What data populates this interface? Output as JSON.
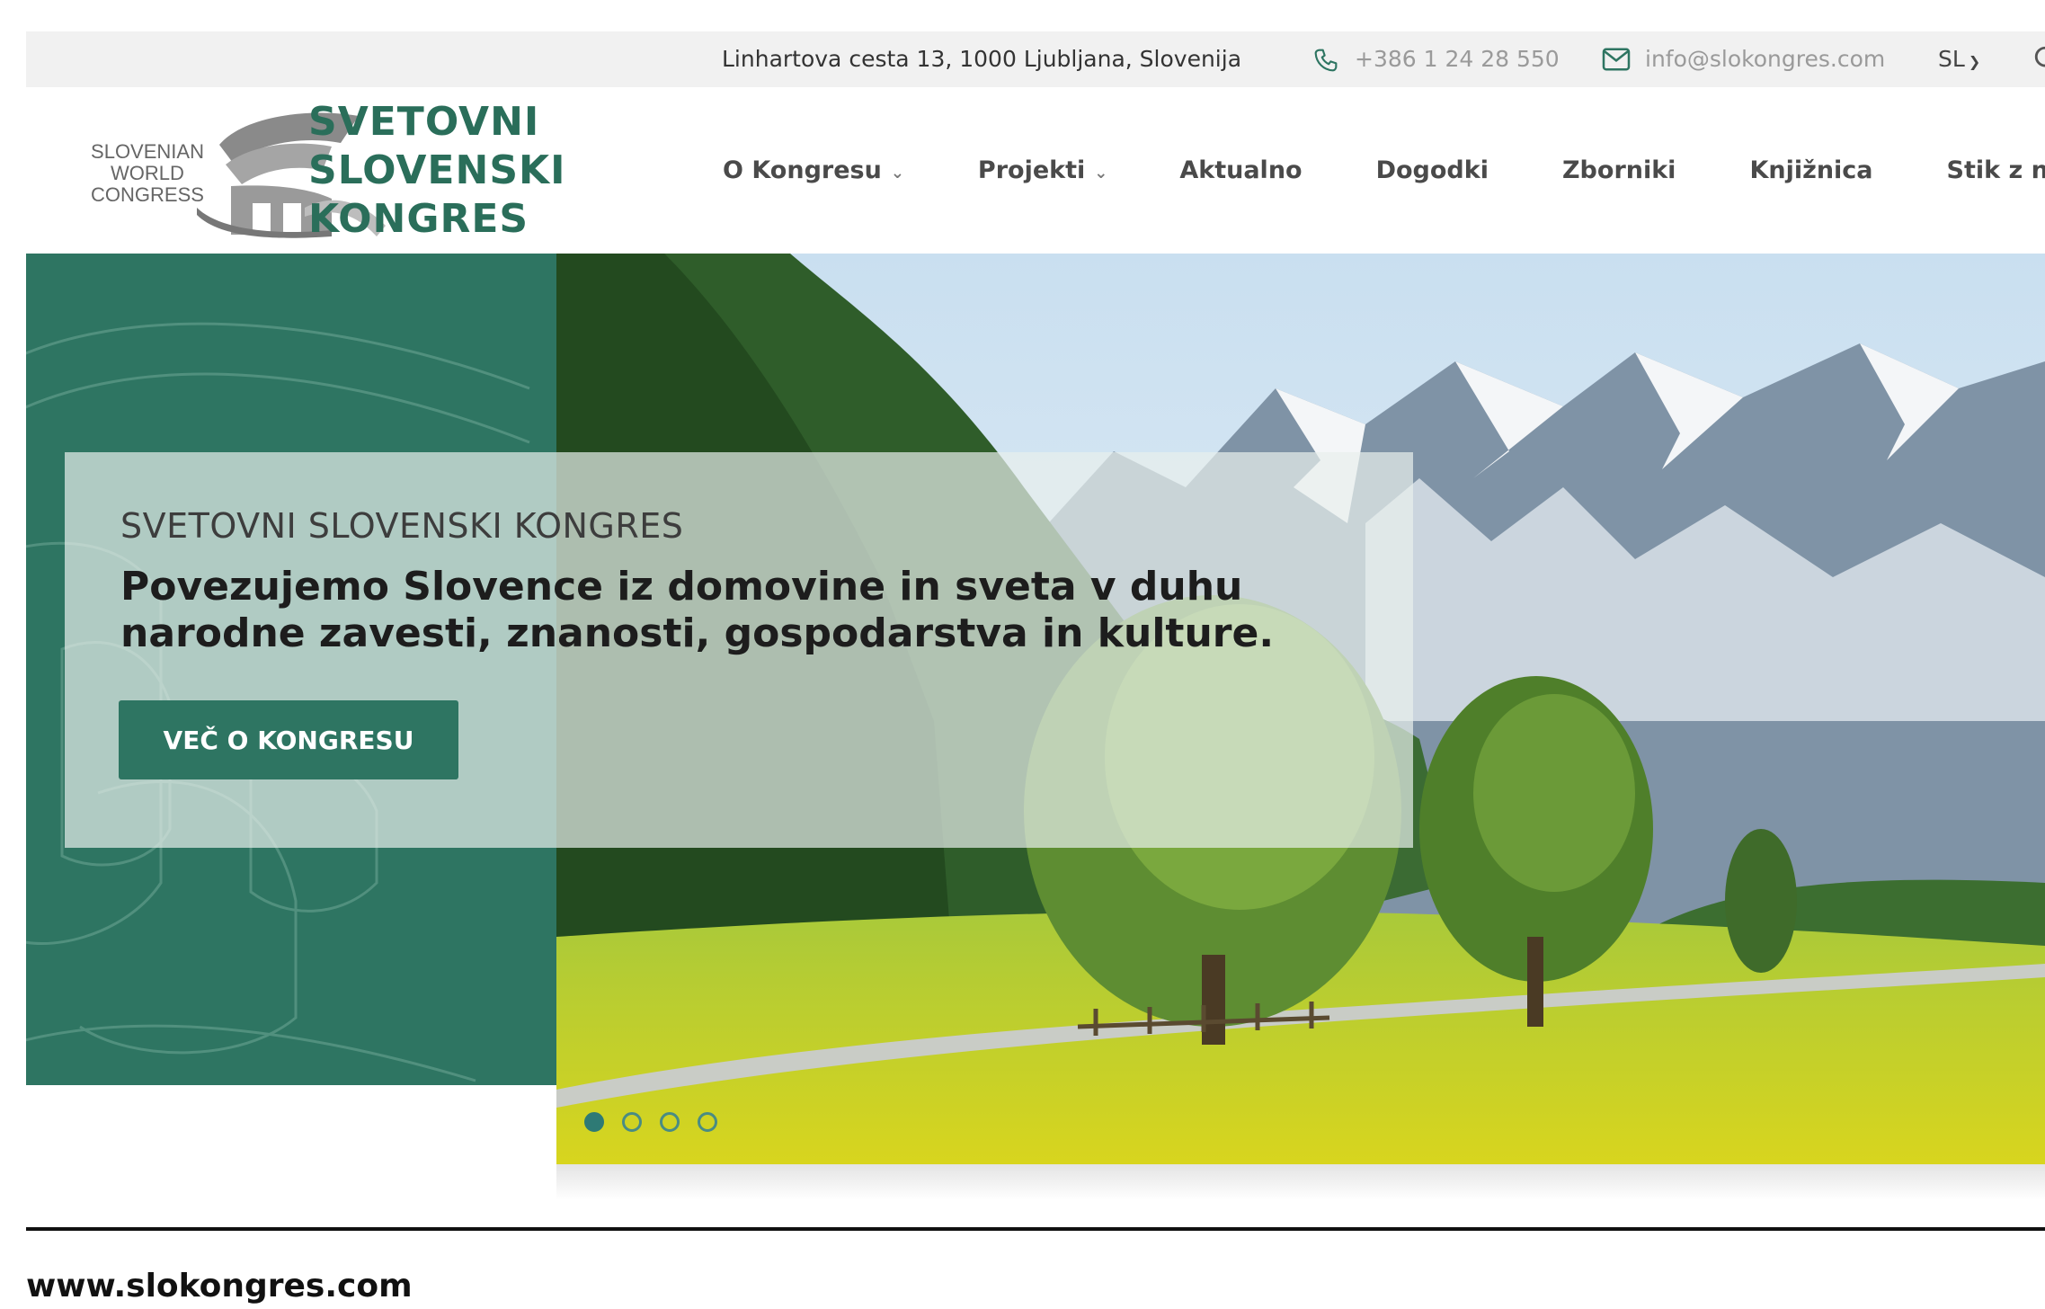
{
  "topbar": {
    "address": "Linhartova cesta 13, 1000 Ljubljana, Slovenija",
    "phone": "+386 1 24 28 550",
    "email": "info@slokongres.com",
    "language": "SL"
  },
  "logo": {
    "english_lines": [
      "SLOVENIAN",
      "WORLD",
      "CONGRESS"
    ],
    "slovene_lines": [
      "SVETOVNI",
      "SLOVENSKI",
      "KONGRES"
    ]
  },
  "nav": {
    "items": [
      {
        "label": "O Kongresu",
        "has_dropdown": true
      },
      {
        "label": "Projekti",
        "has_dropdown": true
      },
      {
        "label": "Aktualno",
        "has_dropdown": false
      },
      {
        "label": "Dogodki",
        "has_dropdown": false
      },
      {
        "label": "Zborniki",
        "has_dropdown": false
      },
      {
        "label": "Knjižnica",
        "has_dropdown": false
      },
      {
        "label": "Stik z nami",
        "has_dropdown": false
      }
    ]
  },
  "hero": {
    "kicker": "SVETOVNI SLOVENSKI KONGRES",
    "tagline": "Povezujemo Slovence iz domovine in sveta v duhu narodne zavesti, znanosti, gospodarstva in kulture.",
    "cta_label": "VEČ O KONGRESU",
    "slide_count": 4,
    "active_slide": 1
  },
  "footer": {
    "url": "www.slokongres.com"
  },
  "colors": {
    "brand_green": "#2e7562",
    "topbar_bg": "#f1f1f1",
    "text_dark": "#1d1d1d"
  },
  "icons": {
    "phone": "phone-icon",
    "email": "mail-icon",
    "search": "search-icon",
    "dropdown": "chevron-down-icon"
  }
}
